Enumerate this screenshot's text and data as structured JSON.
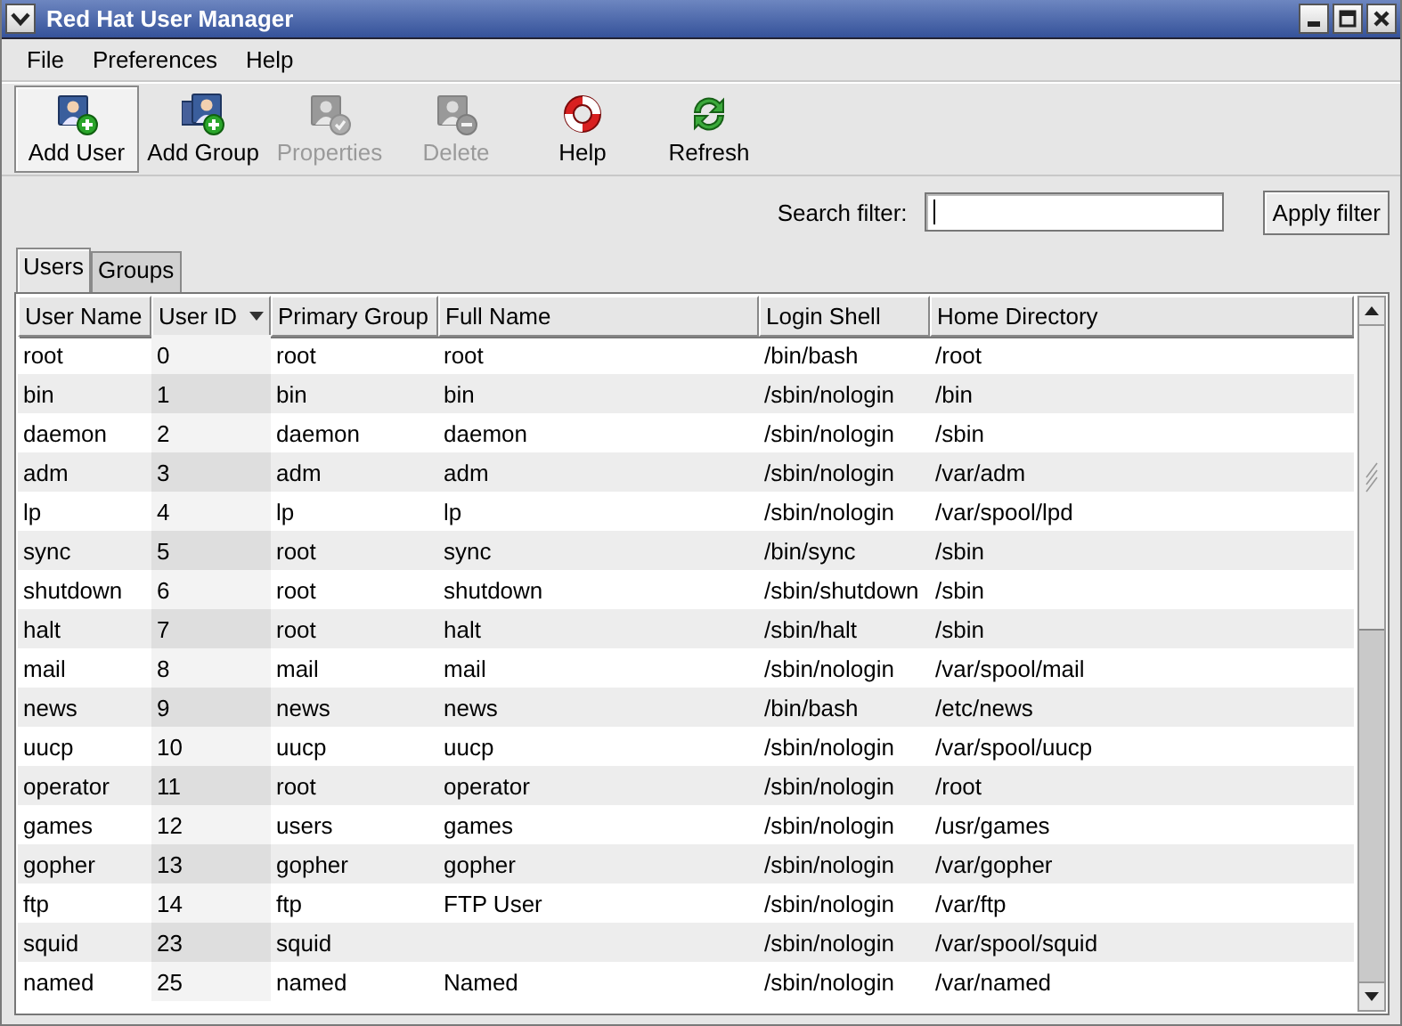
{
  "window": {
    "title": "Red Hat User Manager"
  },
  "menu": [
    "File",
    "Preferences",
    "Help"
  ],
  "toolbar": [
    {
      "label": "Add User",
      "kind": "add-user",
      "disabled": false,
      "focused": true
    },
    {
      "label": "Add Group",
      "kind": "add-group",
      "disabled": false,
      "focused": false
    },
    {
      "label": "Properties",
      "kind": "properties",
      "disabled": true,
      "focused": false
    },
    {
      "label": "Delete",
      "kind": "delete",
      "disabled": true,
      "focused": false
    },
    {
      "label": "Help",
      "kind": "help",
      "disabled": false,
      "focused": false
    },
    {
      "label": "Refresh",
      "kind": "refresh",
      "disabled": false,
      "focused": false
    }
  ],
  "filter": {
    "label": "Search filter:",
    "button": "Apply filter"
  },
  "tabs": [
    {
      "label": "Users",
      "selected": true
    },
    {
      "label": "Groups",
      "selected": false
    }
  ],
  "table": {
    "columns": [
      {
        "label": "User Name",
        "sorted": false
      },
      {
        "label": "User ID",
        "sorted": true
      },
      {
        "label": "Primary Group",
        "sorted": false
      },
      {
        "label": "Full Name",
        "sorted": false
      },
      {
        "label": "Login Shell",
        "sorted": false
      },
      {
        "label": "Home Directory",
        "sorted": false
      }
    ],
    "rows": [
      [
        "root",
        "0",
        "root",
        "root",
        "/bin/bash",
        "/root"
      ],
      [
        "bin",
        "1",
        "bin",
        "bin",
        "/sbin/nologin",
        "/bin"
      ],
      [
        "daemon",
        "2",
        "daemon",
        "daemon",
        "/sbin/nologin",
        "/sbin"
      ],
      [
        "adm",
        "3",
        "adm",
        "adm",
        "/sbin/nologin",
        "/var/adm"
      ],
      [
        "lp",
        "4",
        "lp",
        "lp",
        "/sbin/nologin",
        "/var/spool/lpd"
      ],
      [
        "sync",
        "5",
        "root",
        "sync",
        "/bin/sync",
        "/sbin"
      ],
      [
        "shutdown",
        "6",
        "root",
        "shutdown",
        "/sbin/shutdown",
        "/sbin"
      ],
      [
        "halt",
        "7",
        "root",
        "halt",
        "/sbin/halt",
        "/sbin"
      ],
      [
        "mail",
        "8",
        "mail",
        "mail",
        "/sbin/nologin",
        "/var/spool/mail"
      ],
      [
        "news",
        "9",
        "news",
        "news",
        "/bin/bash",
        "/etc/news"
      ],
      [
        "uucp",
        "10",
        "uucp",
        "uucp",
        "/sbin/nologin",
        "/var/spool/uucp"
      ],
      [
        "operator",
        "11",
        "root",
        "operator",
        "/sbin/nologin",
        "/root"
      ],
      [
        "games",
        "12",
        "users",
        "games",
        "/sbin/nologin",
        "/usr/games"
      ],
      [
        "gopher",
        "13",
        "gopher",
        "gopher",
        "/sbin/nologin",
        "/var/gopher"
      ],
      [
        "ftp",
        "14",
        "ftp",
        "FTP User",
        "/sbin/nologin",
        "/var/ftp"
      ],
      [
        "squid",
        "23",
        "squid",
        null,
        "/sbin/nologin",
        "/var/spool/squid"
      ],
      [
        "named",
        "25",
        "named",
        "Named",
        "/sbin/nologin",
        "/var/named"
      ]
    ]
  }
}
